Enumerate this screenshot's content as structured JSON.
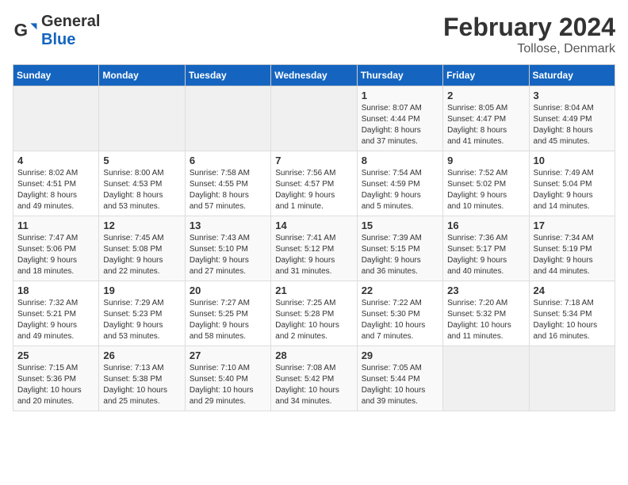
{
  "header": {
    "logo_general": "General",
    "logo_blue": "Blue",
    "title": "February 2024",
    "subtitle": "Tollose, Denmark"
  },
  "days_of_week": [
    "Sunday",
    "Monday",
    "Tuesday",
    "Wednesday",
    "Thursday",
    "Friday",
    "Saturday"
  ],
  "weeks": [
    [
      {
        "day": "",
        "info": ""
      },
      {
        "day": "",
        "info": ""
      },
      {
        "day": "",
        "info": ""
      },
      {
        "day": "",
        "info": ""
      },
      {
        "day": "1",
        "info": "Sunrise: 8:07 AM\nSunset: 4:44 PM\nDaylight: 8 hours\nand 37 minutes."
      },
      {
        "day": "2",
        "info": "Sunrise: 8:05 AM\nSunset: 4:47 PM\nDaylight: 8 hours\nand 41 minutes."
      },
      {
        "day": "3",
        "info": "Sunrise: 8:04 AM\nSunset: 4:49 PM\nDaylight: 8 hours\nand 45 minutes."
      }
    ],
    [
      {
        "day": "4",
        "info": "Sunrise: 8:02 AM\nSunset: 4:51 PM\nDaylight: 8 hours\nand 49 minutes."
      },
      {
        "day": "5",
        "info": "Sunrise: 8:00 AM\nSunset: 4:53 PM\nDaylight: 8 hours\nand 53 minutes."
      },
      {
        "day": "6",
        "info": "Sunrise: 7:58 AM\nSunset: 4:55 PM\nDaylight: 8 hours\nand 57 minutes."
      },
      {
        "day": "7",
        "info": "Sunrise: 7:56 AM\nSunset: 4:57 PM\nDaylight: 9 hours\nand 1 minute."
      },
      {
        "day": "8",
        "info": "Sunrise: 7:54 AM\nSunset: 4:59 PM\nDaylight: 9 hours\nand 5 minutes."
      },
      {
        "day": "9",
        "info": "Sunrise: 7:52 AM\nSunset: 5:02 PM\nDaylight: 9 hours\nand 10 minutes."
      },
      {
        "day": "10",
        "info": "Sunrise: 7:49 AM\nSunset: 5:04 PM\nDaylight: 9 hours\nand 14 minutes."
      }
    ],
    [
      {
        "day": "11",
        "info": "Sunrise: 7:47 AM\nSunset: 5:06 PM\nDaylight: 9 hours\nand 18 minutes."
      },
      {
        "day": "12",
        "info": "Sunrise: 7:45 AM\nSunset: 5:08 PM\nDaylight: 9 hours\nand 22 minutes."
      },
      {
        "day": "13",
        "info": "Sunrise: 7:43 AM\nSunset: 5:10 PM\nDaylight: 9 hours\nand 27 minutes."
      },
      {
        "day": "14",
        "info": "Sunrise: 7:41 AM\nSunset: 5:12 PM\nDaylight: 9 hours\nand 31 minutes."
      },
      {
        "day": "15",
        "info": "Sunrise: 7:39 AM\nSunset: 5:15 PM\nDaylight: 9 hours\nand 36 minutes."
      },
      {
        "day": "16",
        "info": "Sunrise: 7:36 AM\nSunset: 5:17 PM\nDaylight: 9 hours\nand 40 minutes."
      },
      {
        "day": "17",
        "info": "Sunrise: 7:34 AM\nSunset: 5:19 PM\nDaylight: 9 hours\nand 44 minutes."
      }
    ],
    [
      {
        "day": "18",
        "info": "Sunrise: 7:32 AM\nSunset: 5:21 PM\nDaylight: 9 hours\nand 49 minutes."
      },
      {
        "day": "19",
        "info": "Sunrise: 7:29 AM\nSunset: 5:23 PM\nDaylight: 9 hours\nand 53 minutes."
      },
      {
        "day": "20",
        "info": "Sunrise: 7:27 AM\nSunset: 5:25 PM\nDaylight: 9 hours\nand 58 minutes."
      },
      {
        "day": "21",
        "info": "Sunrise: 7:25 AM\nSunset: 5:28 PM\nDaylight: 10 hours\nand 2 minutes."
      },
      {
        "day": "22",
        "info": "Sunrise: 7:22 AM\nSunset: 5:30 PM\nDaylight: 10 hours\nand 7 minutes."
      },
      {
        "day": "23",
        "info": "Sunrise: 7:20 AM\nSunset: 5:32 PM\nDaylight: 10 hours\nand 11 minutes."
      },
      {
        "day": "24",
        "info": "Sunrise: 7:18 AM\nSunset: 5:34 PM\nDaylight: 10 hours\nand 16 minutes."
      }
    ],
    [
      {
        "day": "25",
        "info": "Sunrise: 7:15 AM\nSunset: 5:36 PM\nDaylight: 10 hours\nand 20 minutes."
      },
      {
        "day": "26",
        "info": "Sunrise: 7:13 AM\nSunset: 5:38 PM\nDaylight: 10 hours\nand 25 minutes."
      },
      {
        "day": "27",
        "info": "Sunrise: 7:10 AM\nSunset: 5:40 PM\nDaylight: 10 hours\nand 29 minutes."
      },
      {
        "day": "28",
        "info": "Sunrise: 7:08 AM\nSunset: 5:42 PM\nDaylight: 10 hours\nand 34 minutes."
      },
      {
        "day": "29",
        "info": "Sunrise: 7:05 AM\nSunset: 5:44 PM\nDaylight: 10 hours\nand 39 minutes."
      },
      {
        "day": "",
        "info": ""
      },
      {
        "day": "",
        "info": ""
      }
    ]
  ]
}
